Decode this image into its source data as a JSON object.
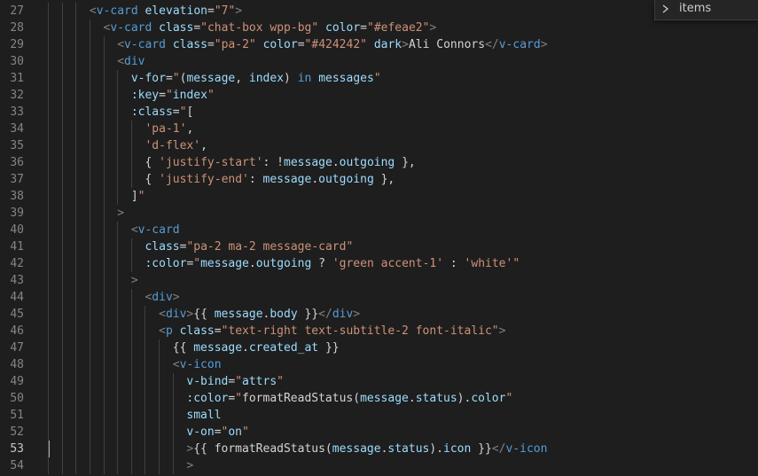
{
  "outline": {
    "label": "items"
  },
  "line_numbers": [
    "27",
    "28",
    "29",
    "30",
    "31",
    "32",
    "33",
    "34",
    "35",
    "36",
    "37",
    "38",
    "39",
    "40",
    "41",
    "42",
    "43",
    "44",
    "45",
    "46",
    "47",
    "48",
    "49",
    "50",
    "51",
    "52",
    "53",
    "54"
  ],
  "active_line": "53",
  "code_lines": [
    {
      "indent": 3,
      "tokens": [
        [
          "br",
          "<"
        ],
        [
          "tag",
          "v-card"
        ],
        [
          "txt",
          " "
        ],
        [
          "attr",
          "elevation"
        ],
        [
          "txt",
          "="
        ],
        [
          "str",
          "\"7\""
        ],
        [
          "br",
          ">"
        ]
      ]
    },
    {
      "indent": 4,
      "tokens": [
        [
          "br",
          "<"
        ],
        [
          "tag",
          "v-card"
        ],
        [
          "txt",
          " "
        ],
        [
          "attr",
          "class"
        ],
        [
          "txt",
          "="
        ],
        [
          "str",
          "\"chat-box wpp-bg\""
        ],
        [
          "txt",
          " "
        ],
        [
          "attr",
          "color"
        ],
        [
          "txt",
          "="
        ],
        [
          "str",
          "\"#efeae2\""
        ],
        [
          "br",
          ">"
        ]
      ]
    },
    {
      "indent": 5,
      "tokens": [
        [
          "br",
          "<"
        ],
        [
          "tag",
          "v-card"
        ],
        [
          "txt",
          " "
        ],
        [
          "attr",
          "class"
        ],
        [
          "txt",
          "="
        ],
        [
          "str",
          "\"pa-2\""
        ],
        [
          "txt",
          " "
        ],
        [
          "attr",
          "color"
        ],
        [
          "txt",
          "="
        ],
        [
          "str",
          "\"#424242\""
        ],
        [
          "txt",
          " "
        ],
        [
          "attr",
          "dark"
        ],
        [
          "br",
          ">"
        ],
        [
          "txt",
          "Ali Connors"
        ],
        [
          "br",
          "</"
        ],
        [
          "tag",
          "v-card"
        ],
        [
          "br",
          ">"
        ]
      ]
    },
    {
      "indent": 5,
      "tokens": [
        [
          "br",
          "<"
        ],
        [
          "tag",
          "div"
        ]
      ]
    },
    {
      "indent": 6,
      "tokens": [
        [
          "attr",
          "v-for"
        ],
        [
          "txt",
          "="
        ],
        [
          "str",
          "\""
        ],
        [
          "txt",
          "("
        ],
        [
          "attr",
          "message"
        ],
        [
          "txt",
          ", "
        ],
        [
          "attr",
          "index"
        ],
        [
          "txt",
          ") "
        ],
        [
          "tag",
          "in"
        ],
        [
          "txt",
          " "
        ],
        [
          "attr",
          "messages"
        ],
        [
          "str",
          "\""
        ]
      ]
    },
    {
      "indent": 6,
      "tokens": [
        [
          "attr",
          ":key"
        ],
        [
          "txt",
          "="
        ],
        [
          "str",
          "\""
        ],
        [
          "attr",
          "index"
        ],
        [
          "str",
          "\""
        ]
      ]
    },
    {
      "indent": 6,
      "tokens": [
        [
          "attr",
          ":class"
        ],
        [
          "txt",
          "="
        ],
        [
          "str",
          "\""
        ],
        [
          "txt",
          "["
        ]
      ]
    },
    {
      "indent": 7,
      "tokens": [
        [
          "str",
          "'pa-1'"
        ],
        [
          "txt",
          ","
        ]
      ]
    },
    {
      "indent": 7,
      "tokens": [
        [
          "str",
          "'d-flex'"
        ],
        [
          "txt",
          ","
        ]
      ]
    },
    {
      "indent": 7,
      "tokens": [
        [
          "txt",
          "{ "
        ],
        [
          "str",
          "'justify-start'"
        ],
        [
          "txt",
          ": !"
        ],
        [
          "attr",
          "message"
        ],
        [
          "txt",
          "."
        ],
        [
          "attr",
          "outgoing"
        ],
        [
          "txt",
          " },"
        ]
      ]
    },
    {
      "indent": 7,
      "tokens": [
        [
          "txt",
          "{ "
        ],
        [
          "str",
          "'justify-end'"
        ],
        [
          "txt",
          ": "
        ],
        [
          "attr",
          "message"
        ],
        [
          "txt",
          "."
        ],
        [
          "attr",
          "outgoing"
        ],
        [
          "txt",
          " },"
        ]
      ]
    },
    {
      "indent": 6,
      "tokens": [
        [
          "txt",
          "]"
        ],
        [
          "str",
          "\""
        ]
      ]
    },
    {
      "indent": 5,
      "tokens": [
        [
          "br",
          ">"
        ]
      ]
    },
    {
      "indent": 6,
      "tokens": [
        [
          "br",
          "<"
        ],
        [
          "tag",
          "v-card"
        ]
      ]
    },
    {
      "indent": 7,
      "tokens": [
        [
          "attr",
          "class"
        ],
        [
          "txt",
          "="
        ],
        [
          "str",
          "\"pa-2 ma-2 message-card\""
        ]
      ]
    },
    {
      "indent": 7,
      "tokens": [
        [
          "attr",
          ":color"
        ],
        [
          "txt",
          "="
        ],
        [
          "str",
          "\""
        ],
        [
          "attr",
          "message"
        ],
        [
          "txt",
          "."
        ],
        [
          "attr",
          "outgoing"
        ],
        [
          "txt",
          " ? "
        ],
        [
          "str",
          "'green accent-1'"
        ],
        [
          "txt",
          " : "
        ],
        [
          "str",
          "'white'"
        ],
        [
          "str",
          "\""
        ]
      ]
    },
    {
      "indent": 6,
      "tokens": [
        [
          "br",
          ">"
        ]
      ]
    },
    {
      "indent": 7,
      "tokens": [
        [
          "br",
          "<"
        ],
        [
          "tag",
          "div"
        ],
        [
          "br",
          ">"
        ]
      ]
    },
    {
      "indent": 8,
      "tokens": [
        [
          "br",
          "<"
        ],
        [
          "tag",
          "div"
        ],
        [
          "br",
          ">"
        ],
        [
          "txt",
          "{{ "
        ],
        [
          "attr",
          "message"
        ],
        [
          "txt",
          "."
        ],
        [
          "attr",
          "body"
        ],
        [
          "txt",
          " }}"
        ],
        [
          "br",
          "</"
        ],
        [
          "tag",
          "div"
        ],
        [
          "br",
          ">"
        ]
      ]
    },
    {
      "indent": 8,
      "tokens": [
        [
          "br",
          "<"
        ],
        [
          "tag",
          "p"
        ],
        [
          "txt",
          " "
        ],
        [
          "attr",
          "class"
        ],
        [
          "txt",
          "="
        ],
        [
          "str",
          "\"text-right text-subtitle-2 font-italic\""
        ],
        [
          "br",
          ">"
        ]
      ]
    },
    {
      "indent": 9,
      "tokens": [
        [
          "txt",
          "{{ "
        ],
        [
          "attr",
          "message"
        ],
        [
          "txt",
          "."
        ],
        [
          "attr",
          "created_at"
        ],
        [
          "txt",
          " }}"
        ]
      ]
    },
    {
      "indent": 9,
      "tokens": [
        [
          "br",
          "<"
        ],
        [
          "tag",
          "v-icon"
        ]
      ]
    },
    {
      "indent": 10,
      "tokens": [
        [
          "attr",
          "v-bind"
        ],
        [
          "txt",
          "="
        ],
        [
          "str",
          "\""
        ],
        [
          "attr",
          "attrs"
        ],
        [
          "str",
          "\""
        ]
      ]
    },
    {
      "indent": 10,
      "tokens": [
        [
          "attr",
          ":color"
        ],
        [
          "txt",
          "="
        ],
        [
          "str",
          "\""
        ],
        [
          "txt",
          "formatReadStatus("
        ],
        [
          "attr",
          "message"
        ],
        [
          "txt",
          "."
        ],
        [
          "attr",
          "status"
        ],
        [
          "txt",
          ")."
        ],
        [
          "attr",
          "color"
        ],
        [
          "str",
          "\""
        ]
      ]
    },
    {
      "indent": 10,
      "tokens": [
        [
          "attr",
          "small"
        ]
      ]
    },
    {
      "indent": 10,
      "tokens": [
        [
          "attr",
          "v-on"
        ],
        [
          "txt",
          "="
        ],
        [
          "str",
          "\""
        ],
        [
          "attr",
          "on"
        ],
        [
          "str",
          "\""
        ]
      ]
    },
    {
      "indent": 10,
      "tokens": [
        [
          "br",
          ">"
        ],
        [
          "txt",
          "{{ "
        ],
        [
          "txt",
          "formatReadStatus("
        ],
        [
          "attr",
          "message"
        ],
        [
          "txt",
          "."
        ],
        [
          "attr",
          "status"
        ],
        [
          "txt",
          ")."
        ],
        [
          "attr",
          "icon"
        ],
        [
          "txt",
          " }}"
        ],
        [
          "br",
          "</"
        ],
        [
          "tag",
          "v-icon"
        ]
      ]
    },
    {
      "indent": 10,
      "tokens": [
        [
          "br",
          ">"
        ]
      ]
    }
  ],
  "colors": {
    "background": "#1e1e1e",
    "tag": "#569cd6",
    "attribute": "#9cdcfe",
    "string": "#ce9178",
    "bracket": "#808080",
    "text": "#d4d4d4",
    "line_number": "#858585"
  }
}
